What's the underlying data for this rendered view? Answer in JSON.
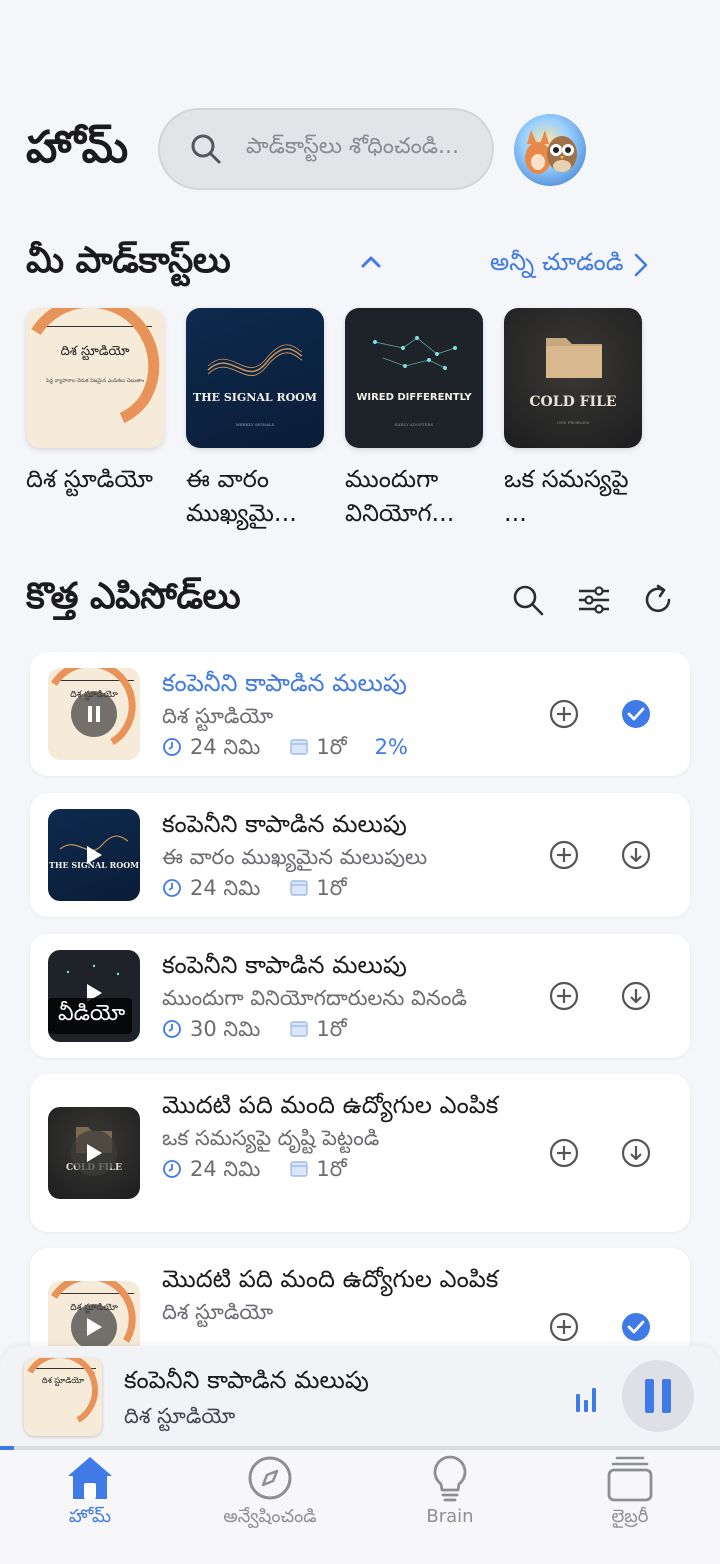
{
  "header": {
    "title": "హోమ్",
    "search_placeholder": "పాడ్‌కాస్ట్‌లు శోధించండి..."
  },
  "podcasts_section": {
    "title": "మీ పాడ్‌కాస్ట్‌లు",
    "see_all": "అన్నీ చూడండి",
    "items": [
      {
        "name": "దిశ స్టూడియో",
        "art_title": "దిశ స్టూడియో",
        "art_tagline": "పెద్ద వ్యాపారాల వెనుక నిజమైన ఎంపికలు చెబుతాం"
      },
      {
        "name": "ఈ వారం ముఖ్యమై...",
        "art_title": "THE SIGNAL ROOM",
        "art_tagline": "WEEKLY SIGNALS"
      },
      {
        "name": "ముందుగా వినియోగ...",
        "art_title": "WIRED DIFFERENTLY",
        "art_tagline": "EARLY ADOPTERS"
      },
      {
        "name": "ఒక సమస్యపై ...",
        "art_title": "COLD FILE",
        "art_tagline": "ONE PROBLEM"
      }
    ]
  },
  "episodes_section": {
    "title": "కొత్త ఎపిసోడ్‌లు",
    "items": [
      {
        "title": "కంపెనీని కాపాడిన మలుపు",
        "show": "దిశ స్టూడియో",
        "duration": "24 నిమి",
        "date": "1రో",
        "progress": "2%",
        "art_title": "దిశ స్టూడియో",
        "state": "playing",
        "downloaded": true
      },
      {
        "title": "కంపెనీని కాపాడిన మలుపు",
        "show": "ఈ వారం ముఖ్యమైన మలుపులు",
        "duration": "24 నిమి",
        "date": "1రో",
        "art_title": "THE SIGNAL ROOM",
        "state": "paused",
        "downloaded": false
      },
      {
        "title": "కంపెనీని కాపాడిన మలుపు",
        "show": "ముందుగా వినియోగదారులను వినండి",
        "duration": "30 నిమి",
        "date": "1రో",
        "art_badge": "వీడియో",
        "state": "paused",
        "downloaded": false
      },
      {
        "title": "మొదటి పది మంది ఉద్యోగుల ఎంపిక",
        "show": "ఒక సమస్యపై దృష్టి పెట్టండి",
        "duration": "24 నిమి",
        "date": "1రో",
        "art_title": "COLD FILE",
        "state": "paused",
        "downloaded": false
      },
      {
        "title": "మొదటి పది మంది ఉద్యోగుల ఎంపిక",
        "show": "దిశ స్టూడియో",
        "art_title": "దిశ స్టూడియో",
        "state": "paused",
        "downloaded": true
      }
    ]
  },
  "mini_player": {
    "title": "కంపెనీని కాపాడిన మలుపు",
    "show": "దిశ స్టూడియో",
    "art_title": "దిశ స్టూడియో",
    "progress": 0.02
  },
  "tabs": [
    {
      "label": "హోమ్",
      "icon": "home-icon",
      "active": true
    },
    {
      "label": "అన్వేషించండి",
      "icon": "compass-icon",
      "active": false
    },
    {
      "label": "Brain",
      "icon": "lightbulb-icon",
      "active": false
    },
    {
      "label": "లైబ్రరీ",
      "icon": "library-icon",
      "active": false
    }
  ],
  "colors": {
    "accent": "#3f7ae6",
    "background": "#f5f6f9"
  }
}
